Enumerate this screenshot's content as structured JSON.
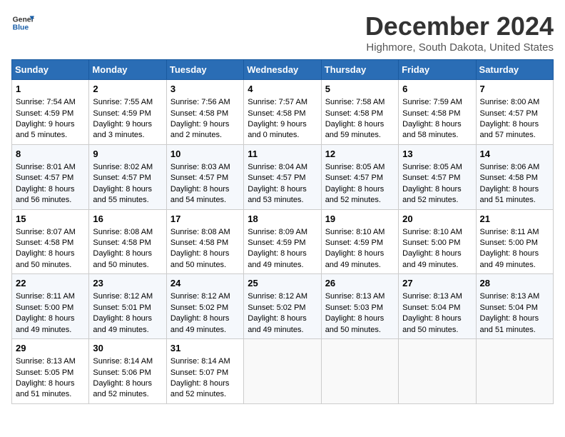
{
  "header": {
    "logo_line1": "General",
    "logo_line2": "Blue",
    "main_title": "December 2024",
    "subtitle": "Highmore, South Dakota, United States"
  },
  "weekdays": [
    "Sunday",
    "Monday",
    "Tuesday",
    "Wednesday",
    "Thursday",
    "Friday",
    "Saturday"
  ],
  "weeks": [
    [
      {
        "day": "1",
        "sunrise": "7:54 AM",
        "sunset": "4:59 PM",
        "daylight": "9 hours and 5 minutes."
      },
      {
        "day": "2",
        "sunrise": "7:55 AM",
        "sunset": "4:59 PM",
        "daylight": "9 hours and 3 minutes."
      },
      {
        "day": "3",
        "sunrise": "7:56 AM",
        "sunset": "4:58 PM",
        "daylight": "9 hours and 2 minutes."
      },
      {
        "day": "4",
        "sunrise": "7:57 AM",
        "sunset": "4:58 PM",
        "daylight": "9 hours and 0 minutes."
      },
      {
        "day": "5",
        "sunrise": "7:58 AM",
        "sunset": "4:58 PM",
        "daylight": "8 hours and 59 minutes."
      },
      {
        "day": "6",
        "sunrise": "7:59 AM",
        "sunset": "4:58 PM",
        "daylight": "8 hours and 58 minutes."
      },
      {
        "day": "7",
        "sunrise": "8:00 AM",
        "sunset": "4:57 PM",
        "daylight": "8 hours and 57 minutes."
      }
    ],
    [
      {
        "day": "8",
        "sunrise": "8:01 AM",
        "sunset": "4:57 PM",
        "daylight": "8 hours and 56 minutes."
      },
      {
        "day": "9",
        "sunrise": "8:02 AM",
        "sunset": "4:57 PM",
        "daylight": "8 hours and 55 minutes."
      },
      {
        "day": "10",
        "sunrise": "8:03 AM",
        "sunset": "4:57 PM",
        "daylight": "8 hours and 54 minutes."
      },
      {
        "day": "11",
        "sunrise": "8:04 AM",
        "sunset": "4:57 PM",
        "daylight": "8 hours and 53 minutes."
      },
      {
        "day": "12",
        "sunrise": "8:05 AM",
        "sunset": "4:57 PM",
        "daylight": "8 hours and 52 minutes."
      },
      {
        "day": "13",
        "sunrise": "8:05 AM",
        "sunset": "4:57 PM",
        "daylight": "8 hours and 52 minutes."
      },
      {
        "day": "14",
        "sunrise": "8:06 AM",
        "sunset": "4:58 PM",
        "daylight": "8 hours and 51 minutes."
      }
    ],
    [
      {
        "day": "15",
        "sunrise": "8:07 AM",
        "sunset": "4:58 PM",
        "daylight": "8 hours and 50 minutes."
      },
      {
        "day": "16",
        "sunrise": "8:08 AM",
        "sunset": "4:58 PM",
        "daylight": "8 hours and 50 minutes."
      },
      {
        "day": "17",
        "sunrise": "8:08 AM",
        "sunset": "4:58 PM",
        "daylight": "8 hours and 50 minutes."
      },
      {
        "day": "18",
        "sunrise": "8:09 AM",
        "sunset": "4:59 PM",
        "daylight": "8 hours and 49 minutes."
      },
      {
        "day": "19",
        "sunrise": "8:10 AM",
        "sunset": "4:59 PM",
        "daylight": "8 hours and 49 minutes."
      },
      {
        "day": "20",
        "sunrise": "8:10 AM",
        "sunset": "5:00 PM",
        "daylight": "8 hours and 49 minutes."
      },
      {
        "day": "21",
        "sunrise": "8:11 AM",
        "sunset": "5:00 PM",
        "daylight": "8 hours and 49 minutes."
      }
    ],
    [
      {
        "day": "22",
        "sunrise": "8:11 AM",
        "sunset": "5:00 PM",
        "daylight": "8 hours and 49 minutes."
      },
      {
        "day": "23",
        "sunrise": "8:12 AM",
        "sunset": "5:01 PM",
        "daylight": "8 hours and 49 minutes."
      },
      {
        "day": "24",
        "sunrise": "8:12 AM",
        "sunset": "5:02 PM",
        "daylight": "8 hours and 49 minutes."
      },
      {
        "day": "25",
        "sunrise": "8:12 AM",
        "sunset": "5:02 PM",
        "daylight": "8 hours and 49 minutes."
      },
      {
        "day": "26",
        "sunrise": "8:13 AM",
        "sunset": "5:03 PM",
        "daylight": "8 hours and 50 minutes."
      },
      {
        "day": "27",
        "sunrise": "8:13 AM",
        "sunset": "5:04 PM",
        "daylight": "8 hours and 50 minutes."
      },
      {
        "day": "28",
        "sunrise": "8:13 AM",
        "sunset": "5:04 PM",
        "daylight": "8 hours and 51 minutes."
      }
    ],
    [
      {
        "day": "29",
        "sunrise": "8:13 AM",
        "sunset": "5:05 PM",
        "daylight": "8 hours and 51 minutes."
      },
      {
        "day": "30",
        "sunrise": "8:14 AM",
        "sunset": "5:06 PM",
        "daylight": "8 hours and 52 minutes."
      },
      {
        "day": "31",
        "sunrise": "8:14 AM",
        "sunset": "5:07 PM",
        "daylight": "8 hours and 52 minutes."
      },
      null,
      null,
      null,
      null
    ]
  ],
  "labels": {
    "sunrise": "Sunrise:",
    "sunset": "Sunset:",
    "daylight": "Daylight:"
  }
}
